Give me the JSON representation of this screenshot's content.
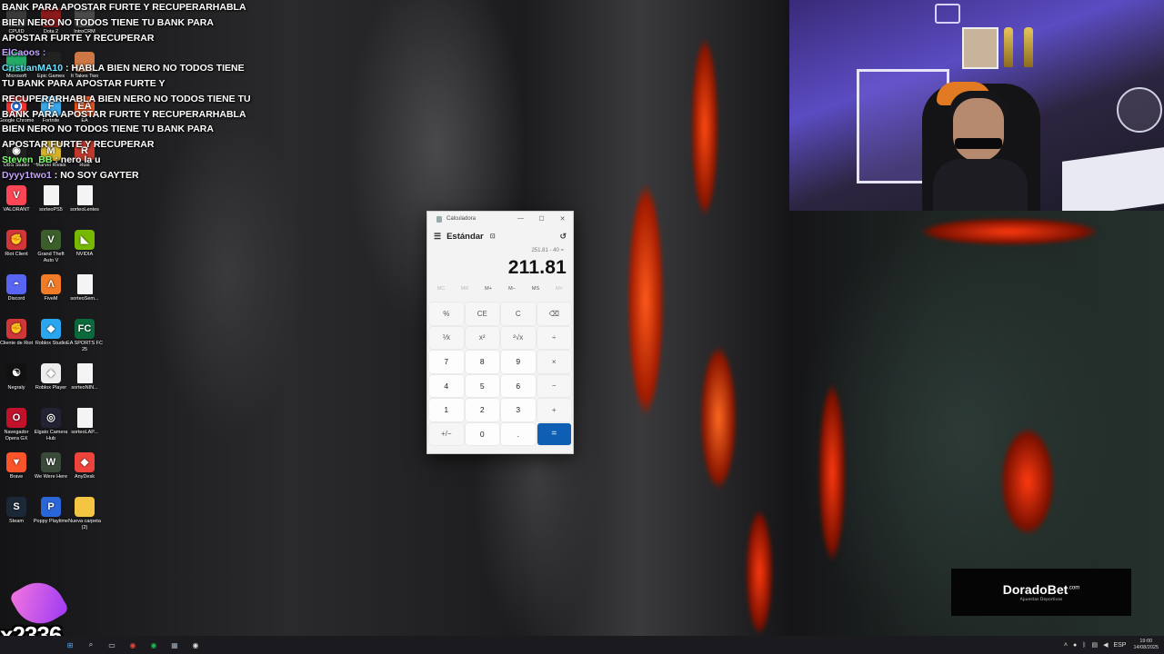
{
  "chat": [
    {
      "user": "",
      "text": "BANK PARA APOSTAR FURTE Y RECUPERARHABLA"
    },
    {
      "user": "",
      "text": "BIEN NERO NO TODOS TIENE TU BANK PARA"
    },
    {
      "user": "",
      "text": "APOSTAR FURTE Y RECUPERAR"
    },
    {
      "user": "ElCaoos :",
      "text": "",
      "color": "p"
    },
    {
      "user": "CristianMA10",
      "text": ": HABLA BIEN NERO NO TODOS TIENE"
    },
    {
      "user": "",
      "text": "TU BANK PARA APOSTAR FURTE Y"
    },
    {
      "user": "",
      "text": "RECUPERARHABLA BIEN NERO NO TODOS TIENE TU"
    },
    {
      "user": "",
      "text": "BANK PARA APOSTAR FURTE Y RECUPERARHABLA"
    },
    {
      "user": "",
      "text": "BIEN NERO NO TODOS TIENE TU BANK PARA"
    },
    {
      "user": "",
      "text": "APOSTAR FURTE Y RECUPERAR"
    },
    {
      "user": "Steven_BB",
      "text": ": nero la u",
      "color": "g"
    },
    {
      "user": "Dyyy1two1",
      "text": ": NO SOY GAYTER",
      "color": "p"
    }
  ],
  "desktop": {
    "icons": [
      {
        "name": "icon-cpuid",
        "label": "CPUID",
        "glyph": "",
        "bg": "#3a3a3a"
      },
      {
        "name": "icon-dota2",
        "label": "Dota 2",
        "glyph": "",
        "bg": "#8b1a1a"
      },
      {
        "name": "icon-introcrm",
        "label": "IntroCRM",
        "glyph": "",
        "bg": "#4a4a4a"
      },
      {
        "name": "icon-microsoft",
        "label": "Microsoft",
        "glyph": "",
        "bg": "#2a6"
      },
      {
        "name": "icon-epic-games",
        "label": "Epic Games",
        "glyph": "",
        "bg": "#222"
      },
      {
        "name": "icon-it-takes-two",
        "label": "It Takes Two",
        "glyph": "",
        "bg": "#c74"
      },
      {
        "name": "icon-google-chrome",
        "label": "Google Chrome",
        "glyph": "●",
        "bg": "radial-gradient(circle,#1a73e8 30%,#fff 32%,#fff 38%,#e33 40%)"
      },
      {
        "name": "icon-fortnite",
        "label": "Fortnite",
        "glyph": "F",
        "bg": "#3ba7e8"
      },
      {
        "name": "icon-ea",
        "label": "EA",
        "glyph": "EA",
        "bg": "#e2501e"
      },
      {
        "name": "icon-obs-studio",
        "label": "OBS Studio",
        "glyph": "◉",
        "bg": "#222"
      },
      {
        "name": "icon-marvel-rivals",
        "label": "Marvel Rivals",
        "glyph": "M",
        "bg": "#d6b22a"
      },
      {
        "name": "icon-rust",
        "label": "Rust",
        "glyph": "R",
        "bg": "#c0392b"
      },
      {
        "name": "icon-valorant",
        "label": "VALORANT",
        "glyph": "V",
        "bg": "#fd4556"
      },
      {
        "name": "icon-sorteops5",
        "label": "sorteoPS5",
        "glyph": "",
        "bg": "doc"
      },
      {
        "name": "icon-sorteolentes",
        "label": "sorteoLentes",
        "glyph": "",
        "bg": "doc"
      },
      {
        "name": "icon-riot-client",
        "label": "Riot Client",
        "glyph": "✊",
        "bg": "#d13639"
      },
      {
        "name": "icon-gta5",
        "label": "Grand Theft Auto V",
        "glyph": "V",
        "bg": "#3b5e2b"
      },
      {
        "name": "icon-nvidia",
        "label": "NVIDIA",
        "glyph": "◣",
        "bg": "#76b900"
      },
      {
        "name": "icon-discord",
        "label": "Discord",
        "glyph": "◓",
        "bg": "#5865f2"
      },
      {
        "name": "icon-fivem",
        "label": "FiveM",
        "glyph": "Λ",
        "bg": "#f17b27"
      },
      {
        "name": "icon-sorteosem",
        "label": "sorteoSem...",
        "glyph": "",
        "bg": "doc"
      },
      {
        "name": "icon-cliente-riot",
        "label": "Cliente de Riot",
        "glyph": "✊",
        "bg": "#d13639"
      },
      {
        "name": "icon-roblox-studio",
        "label": "Roblox Studio",
        "glyph": "◆",
        "bg": "#2aa6f0"
      },
      {
        "name": "icon-ea-fc25",
        "label": "EA SPORTS FC 25",
        "glyph": "FC",
        "bg": "#0b6a3c"
      },
      {
        "name": "icon-negraly",
        "label": "Negraly",
        "glyph": "☯",
        "bg": "#111"
      },
      {
        "name": "icon-roblox-player",
        "label": "Roblox Player",
        "glyph": "◆",
        "bg": "#eee"
      },
      {
        "name": "icon-sorteonin",
        "label": "sorteoNIN...",
        "glyph": "",
        "bg": "doc"
      },
      {
        "name": "icon-opera-gx",
        "label": "Navegador Opera GX",
        "glyph": "O",
        "bg": "#c0122b"
      },
      {
        "name": "icon-elgato",
        "label": "Elgato Camera Hub",
        "glyph": "◎",
        "bg": "#223"
      },
      {
        "name": "icon-sorteolap",
        "label": "sorteoLAP...",
        "glyph": "",
        "bg": "doc"
      },
      {
        "name": "icon-brave",
        "label": "Brave",
        "glyph": "▼",
        "bg": "#fb542b"
      },
      {
        "name": "icon-we-were-here",
        "label": "We Were Here",
        "glyph": "W",
        "bg": "#3a4a3a"
      },
      {
        "name": "icon-anydesk",
        "label": "AnyDesk",
        "glyph": "◆",
        "bg": "#ef443b"
      },
      {
        "name": "icon-steam",
        "label": "Steam",
        "glyph": "S",
        "bg": "#1b2838"
      },
      {
        "name": "icon-poppy-playtime",
        "label": "Poppy Playtime",
        "glyph": "P",
        "bg": "#2a66d9"
      },
      {
        "name": "icon-nueva-carpeta",
        "label": "Nueva carpeta (2)",
        "glyph": "",
        "bg": "#f4c542"
      }
    ]
  },
  "calculator": {
    "title": "Calculadora",
    "mode": "Estándar",
    "keep_on_top_icon": "⊡",
    "history_icon": "↺",
    "expression": "251.81 - 40 =",
    "result": "211.81",
    "memory": [
      {
        "label": "MC",
        "enabled": false
      },
      {
        "label": "MR",
        "enabled": false
      },
      {
        "label": "M+",
        "enabled": true
      },
      {
        "label": "M−",
        "enabled": true
      },
      {
        "label": "MS",
        "enabled": true
      },
      {
        "label": "M˅",
        "enabled": false
      }
    ],
    "keys": [
      {
        "label": "%",
        "t": "op",
        "name": "percent-key"
      },
      {
        "label": "CE",
        "t": "op",
        "name": "clear-entry-key"
      },
      {
        "label": "C",
        "t": "op",
        "name": "clear-key"
      },
      {
        "label": "⌫",
        "t": "op",
        "name": "backspace-key"
      },
      {
        "label": "⅟x",
        "t": "op",
        "name": "reciprocal-key"
      },
      {
        "label": "x²",
        "t": "op",
        "name": "square-key"
      },
      {
        "label": "²√x",
        "t": "op",
        "name": "sqrt-key"
      },
      {
        "label": "÷",
        "t": "op",
        "name": "divide-key"
      },
      {
        "label": "7",
        "t": "num",
        "name": "digit-7-key"
      },
      {
        "label": "8",
        "t": "num",
        "name": "digit-8-key"
      },
      {
        "label": "9",
        "t": "num",
        "name": "digit-9-key"
      },
      {
        "label": "×",
        "t": "op",
        "name": "multiply-key"
      },
      {
        "label": "4",
        "t": "num",
        "name": "digit-4-key"
      },
      {
        "label": "5",
        "t": "num",
        "name": "digit-5-key"
      },
      {
        "label": "6",
        "t": "num",
        "name": "digit-6-key"
      },
      {
        "label": "−",
        "t": "op",
        "name": "minus-key"
      },
      {
        "label": "1",
        "t": "num",
        "name": "digit-1-key"
      },
      {
        "label": "2",
        "t": "num",
        "name": "digit-2-key"
      },
      {
        "label": "3",
        "t": "num",
        "name": "digit-3-key"
      },
      {
        "label": "+",
        "t": "op",
        "name": "plus-key"
      },
      {
        "label": "+/−",
        "t": "op",
        "name": "negate-key"
      },
      {
        "label": "0",
        "t": "num",
        "name": "digit-0-key"
      },
      {
        "label": ".",
        "t": "num",
        "name": "decimal-key"
      },
      {
        "label": "=",
        "t": "eq",
        "name": "equals-key"
      }
    ]
  },
  "sponsor": {
    "brand": "DoradoBet",
    "suffix": ".com",
    "tagline": "Apuestas Deportivas"
  },
  "bits_overlay": "x2336",
  "taskbar": {
    "apps": [
      {
        "name": "start-icon",
        "glyph": "⊞",
        "color": "#4aa8ff"
      },
      {
        "name": "search-icon",
        "glyph": "⌕",
        "color": "#ddd"
      },
      {
        "name": "taskview-icon",
        "glyph": "▭",
        "color": "#ddd"
      },
      {
        "name": "chrome-taskbar-icon",
        "glyph": "◉",
        "color": "#e8453c"
      },
      {
        "name": "spotify-taskbar-icon",
        "glyph": "◉",
        "color": "#1db954"
      },
      {
        "name": "calculator-taskbar-icon",
        "glyph": "▦",
        "color": "#9ab"
      },
      {
        "name": "obs-taskbar-icon",
        "glyph": "◉",
        "color": "#ddd"
      }
    ],
    "tray": {
      "language": "ESP",
      "time": "19:00",
      "date": "14/08/2025"
    }
  }
}
